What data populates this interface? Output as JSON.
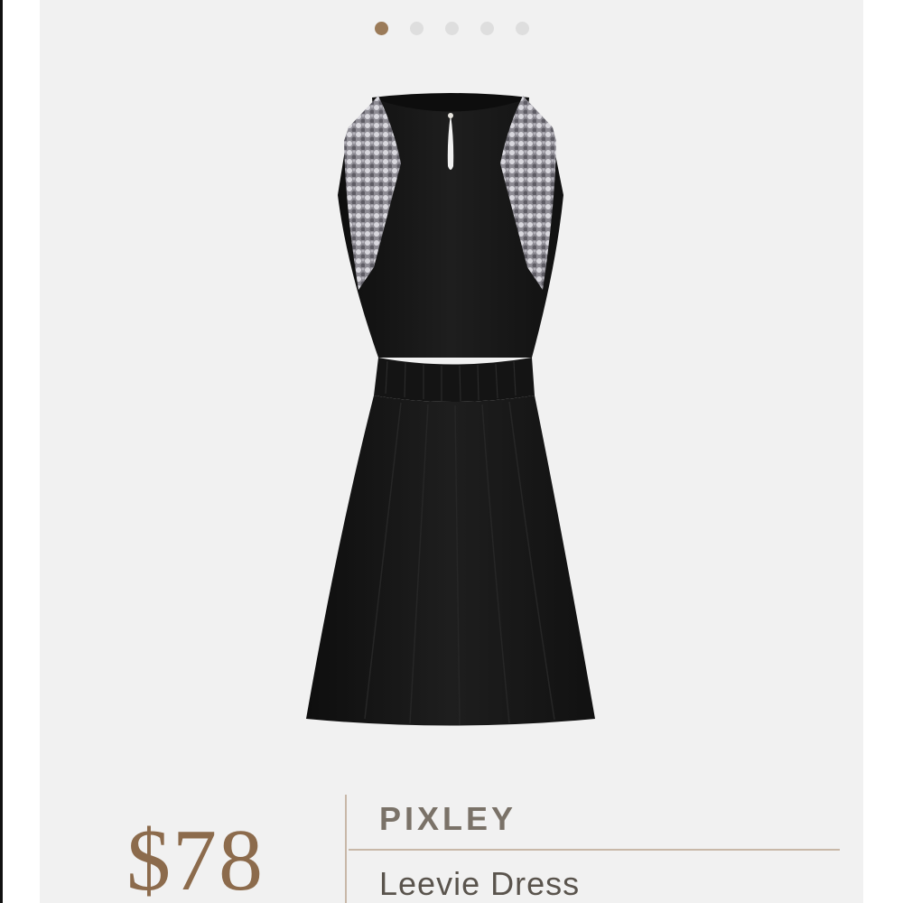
{
  "carousel": {
    "total": 5,
    "active_index": 0,
    "active_color": "#9b7b59",
    "inactive_color": "#dedede"
  },
  "product": {
    "image_icon": "dress-image",
    "price": "$78",
    "brand": "PIXLEY",
    "name": "Leevie Dress"
  },
  "colors": {
    "accent": "#8c6b4c",
    "background": "#f1f1f1"
  }
}
